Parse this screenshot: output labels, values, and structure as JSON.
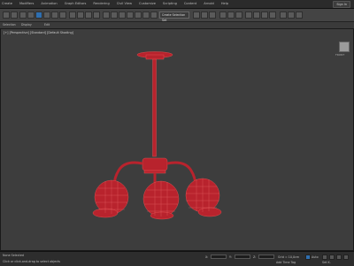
{
  "menu": {
    "items": [
      "Create",
      "Modifiers",
      "Animation",
      "Graph Editors",
      "Rendering",
      "Civil View",
      "Customize",
      "Scripting",
      "Content",
      "Arnold",
      "Help"
    ],
    "sign_in": "Sign In"
  },
  "toolbar": {
    "selection_set_placeholder": "Create Selection Set"
  },
  "ribbon": {
    "tabs": [
      "Selection",
      "Display",
      "Edit"
    ]
  },
  "viewport": {
    "label": "[+] [Perspective] [Standard] [Default Shading]",
    "viewcube_label": "FRONT",
    "model_color": "#c4303a"
  },
  "statusbar": {
    "left_text": "None Selected",
    "prompt": "Click or click-and-drag to select objects",
    "x_label": "X:",
    "y_label": "Y:",
    "z_label": "Z:",
    "grid": "Grid = 10,0cm",
    "add_time_tag": "Add Time Tag",
    "auto": "Auto",
    "set_key": "Set K."
  }
}
